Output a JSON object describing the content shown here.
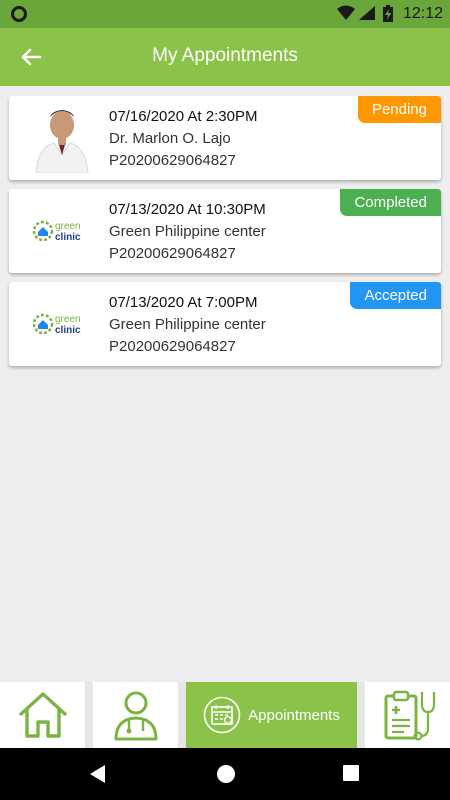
{
  "status_bar": {
    "time": "12:12"
  },
  "app_bar": {
    "title": "My Appointments",
    "back_icon": "arrow-left-icon"
  },
  "appointments": [
    {
      "datetime": "07/16/2020 At 2:30PM",
      "provider": "Dr. Marlon O. Lajo",
      "code": "P20200629064827",
      "status": "Pending",
      "status_color": "#ff9800",
      "thumb": "doctor-photo"
    },
    {
      "datetime": "07/13/2020 At 10:30PM",
      "provider": "Green Philippine center",
      "code": "P20200629064827",
      "status": "Completed",
      "status_color": "#4caf50",
      "thumb": "green-clinic-logo"
    },
    {
      "datetime": "07/13/2020 At 7:00PM",
      "provider": "Green Philippine center",
      "code": "P20200629064827",
      "status": "Accepted",
      "status_color": "#2196f3",
      "thumb": "green-clinic-logo"
    }
  ],
  "clinic_logo": {
    "line1": "green",
    "line2": "clinic"
  },
  "bottom_nav": {
    "items": [
      {
        "icon": "home-icon"
      },
      {
        "icon": "doctor-icon"
      },
      {
        "icon": "calendar-icon",
        "label": "Appointments",
        "active": true
      },
      {
        "icon": "clipboard-stethoscope-icon"
      }
    ]
  },
  "colors": {
    "primary": "#8bc34a",
    "status_bar": "#6aa63a",
    "pending": "#ff9800",
    "completed": "#4caf50",
    "accepted": "#2196f3"
  }
}
